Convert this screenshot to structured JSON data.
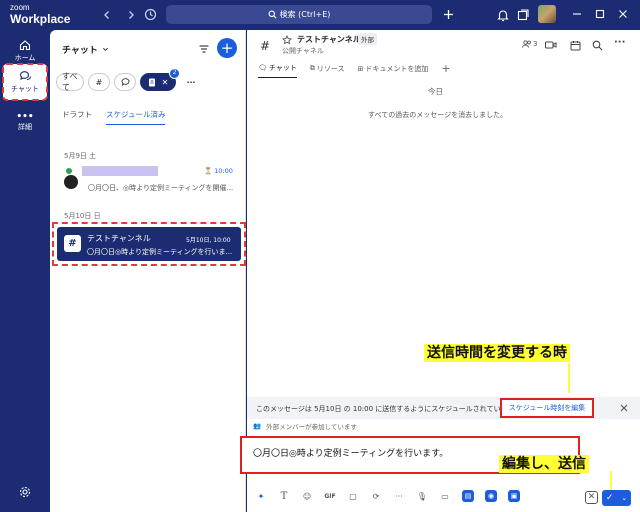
{
  "app": {
    "brand_line1": "zoom",
    "brand_line2": "Workplace"
  },
  "titlebar": {
    "search_text": "検索 (Ctrl+E)"
  },
  "rail": {
    "home": "ホーム",
    "chat": "チャット",
    "more": "詳細"
  },
  "panel": {
    "title": "チャット",
    "filters": {
      "all": "すべて",
      "badge": "2"
    },
    "subtabs": {
      "draft": "ドラフト",
      "scheduled": "スケジュール済み"
    },
    "date1": "5月9日 土",
    "item1": {
      "time": "10:00",
      "preview": "〇月〇日、◎時より定例ミーティングを開催..."
    },
    "date2": "5月10日 日",
    "item2": {
      "name": "テストチャンネル",
      "time": "5月10日, 10:00",
      "preview": "〇月〇日◎時より定例ミーティングを行いま..."
    }
  },
  "channel": {
    "name": "テストチャンネル",
    "external_tag": "外部",
    "subtitle": "公開チャネル",
    "member_count": "3",
    "tabs": {
      "chat": "チャット",
      "resources": "リソース",
      "add_doc": "ドキュメントを追加"
    }
  },
  "messages": {
    "today": "今日",
    "cleared": "すべての過去のメッセージを消去しました。"
  },
  "schedule": {
    "message": "このメッセージは 5月10日 の 10:00 に送信するようにスケジュールされています。",
    "edit_label": "スケジュール時刻を編集",
    "external_note": "外部メンバーが参加しています"
  },
  "composer": {
    "text": "〇月〇日◎時より定例ミーティングを行います。"
  },
  "annotations": {
    "change_time": "送信時間を変更する時",
    "edit_send": "編集し、送信"
  }
}
